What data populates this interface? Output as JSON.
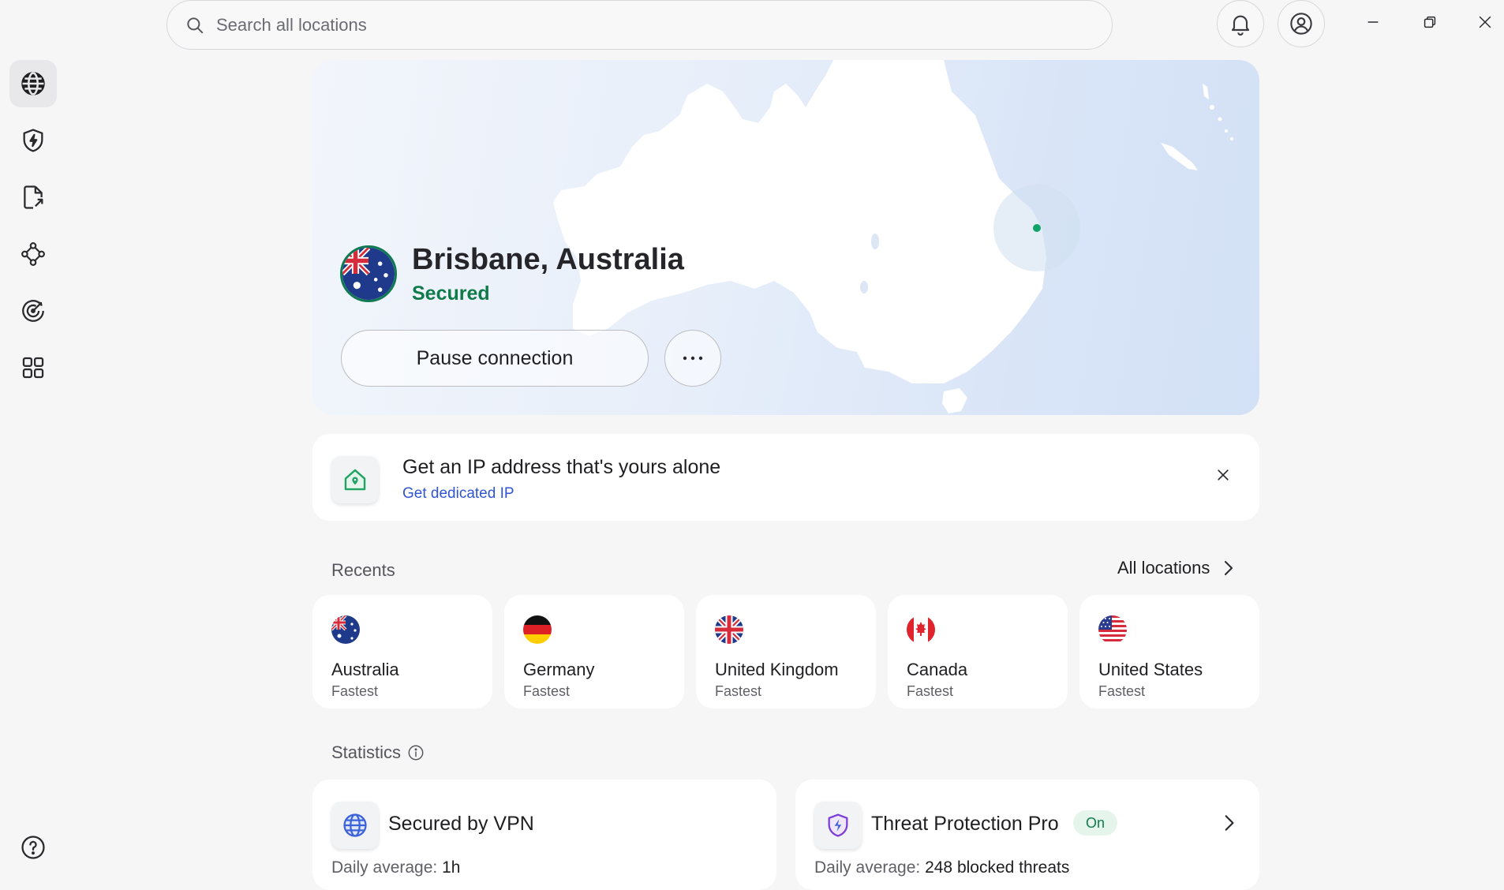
{
  "search": {
    "placeholder": "Search all locations"
  },
  "topbar": {
    "icons": [
      "bell-icon",
      "account-icon"
    ],
    "window_controls": [
      "minimize-icon",
      "restore-icon",
      "close-icon"
    ]
  },
  "sidebar": {
    "items": [
      {
        "name": "globe-icon",
        "active": true
      },
      {
        "name": "shield-bolt-icon",
        "active": false
      },
      {
        "name": "file-share-icon",
        "active": false
      },
      {
        "name": "mesh-network-icon",
        "active": false
      },
      {
        "name": "target-icon",
        "active": false
      },
      {
        "name": "apps-grid-icon",
        "active": false
      }
    ],
    "help_icon": "help-icon"
  },
  "connection": {
    "location": "Brisbane, Australia",
    "status": "Secured",
    "pause_label": "Pause connection",
    "more_icon": "more-horizontal-icon"
  },
  "promo": {
    "title": "Get an IP address that's yours alone",
    "link": "Get dedicated IP"
  },
  "recents": {
    "label": "Recents",
    "all_locations": "All locations",
    "items": [
      {
        "country": "Australia",
        "sub": "Fastest"
      },
      {
        "country": "Germany",
        "sub": "Fastest"
      },
      {
        "country": "United Kingdom",
        "sub": "Fastest"
      },
      {
        "country": "Canada",
        "sub": "Fastest"
      },
      {
        "country": "United States",
        "sub": "Fastest"
      }
    ]
  },
  "statistics": {
    "label": "Statistics",
    "cards": [
      {
        "title": "Secured by VPN",
        "prefix": "Daily average:",
        "value": "1h"
      },
      {
        "title": "Threat Protection Pro",
        "badge": "On",
        "prefix": "Daily average:",
        "value": "248 blocked threats"
      }
    ]
  },
  "colors": {
    "accent_green": "#0f7a4a",
    "link_blue": "#2f55d4",
    "background": "#f6f6f7",
    "map_dot": "#10a36a"
  }
}
